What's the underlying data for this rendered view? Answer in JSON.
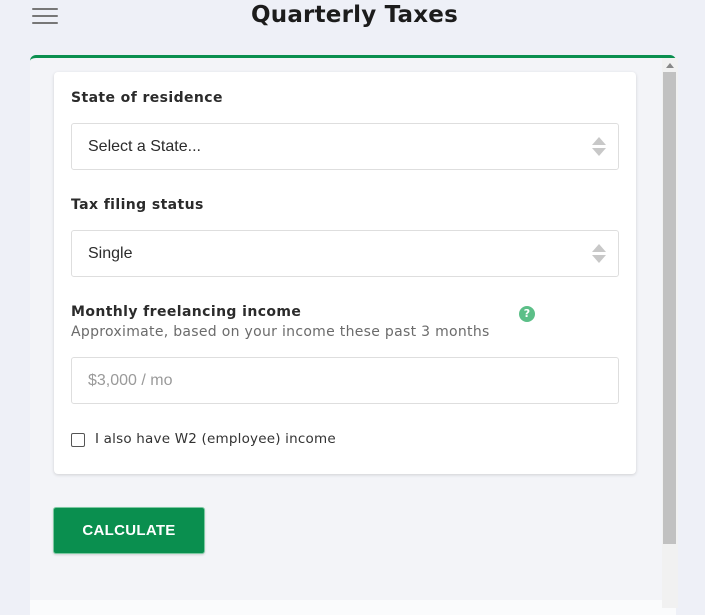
{
  "header": {
    "title": "Quarterly Taxes",
    "menu_icon": "hamburger-menu-icon"
  },
  "form": {
    "state": {
      "label": "State of residence",
      "value": "Select a State..."
    },
    "filing_status": {
      "label": "Tax filing status",
      "value": "Single"
    },
    "income": {
      "label": "Monthly freelancing income",
      "sublabel": "Approximate, based on your income these past 3 months",
      "placeholder": "$3,000 / mo",
      "help_icon": "question-mark-icon",
      "help_glyph": "?"
    },
    "w2": {
      "label": "I also have W2 (employee) income",
      "checked": false
    }
  },
  "calculate_button": {
    "label": "CALCULATE"
  },
  "colors": {
    "accent": "#0a8f4f",
    "help": "#5cbf88",
    "background": "#eef0f7"
  }
}
